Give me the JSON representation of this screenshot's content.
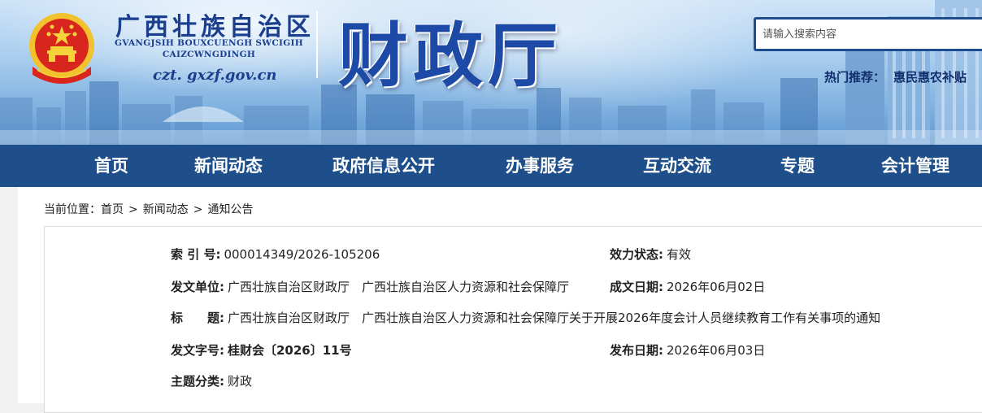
{
  "header": {
    "region_cn": "广西壮族自治区",
    "region_en_line1": "GVANGJSIH BOUXCUENGH SWCIGIH",
    "region_en_line2": "CAIZCWNGDINGH",
    "site_url": "czt. gxzf.gov.cn",
    "department": "财政厅",
    "search_placeholder": "请输入搜索内容",
    "hot_label": "热门推荐：",
    "hot_item": "惠民惠农补贴"
  },
  "nav": {
    "items": [
      "首页",
      "新闻动态",
      "政府信息公开",
      "办事服务",
      "互动交流",
      "专题",
      "会计管理"
    ]
  },
  "breadcrumb": {
    "prefix": "当前位置：",
    "items": [
      "首页",
      "新闻动态",
      "通知公告"
    ],
    "separator": ">"
  },
  "doc_info": {
    "index_label": "索  引  号:",
    "index_value": "000014349/2026-105206",
    "status_label": "效力状态:",
    "status_value": "有效",
    "issuer_label": "发文单位:",
    "issuer_value": "广西壮族自治区财政厅　广西壮族自治区人力资源和社会保障厅",
    "created_label": "成文日期:",
    "created_value": "2026年06月02日",
    "title_label": "标　　题:",
    "title_value": "广西壮族自治区财政厅　广西壮族自治区人力资源和社会保障厅关于开展2026年度会计人员继续教育工作有关事项的通知",
    "docno_label": "发文字号:",
    "docno_value": "桂财会〔2026〕11号",
    "published_label": "发布日期:",
    "published_value": "2026年06月03日",
    "topic_label": "主题分类:",
    "topic_value": "财政"
  }
}
